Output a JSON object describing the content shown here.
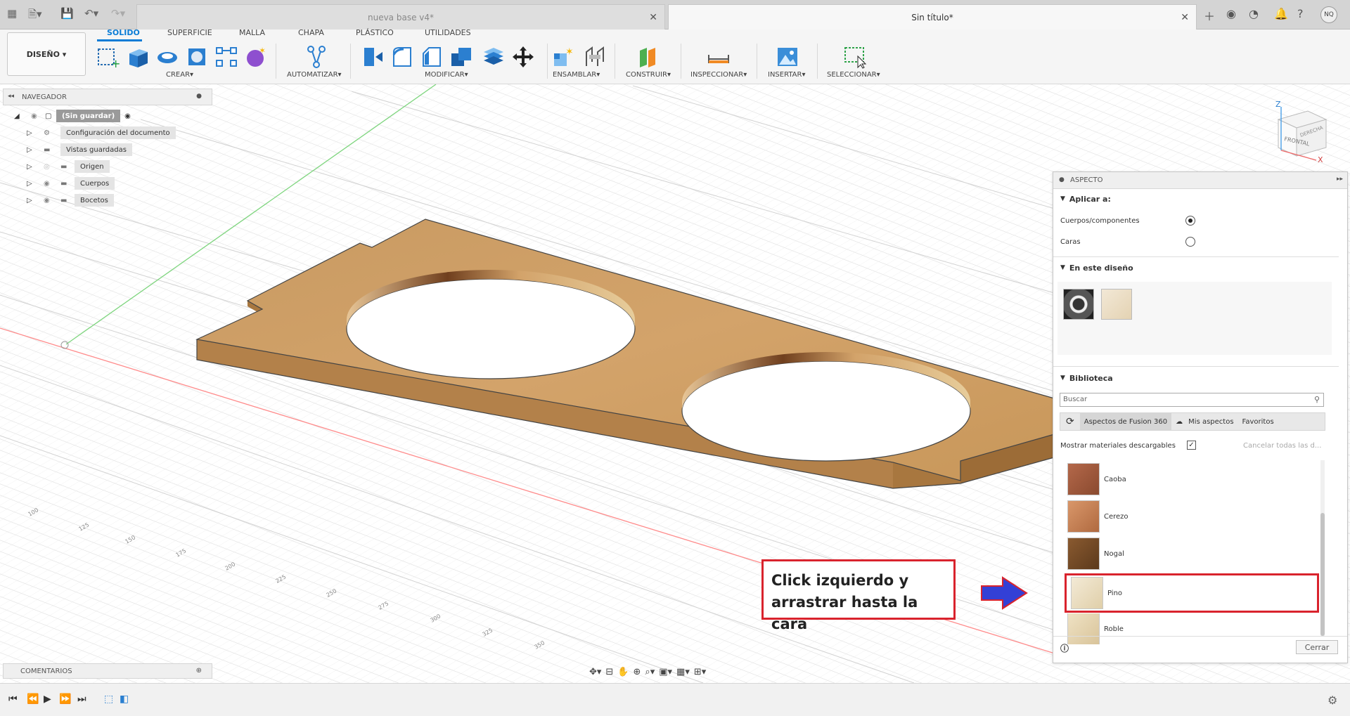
{
  "tabs": {
    "inactive": "nueva base v4*",
    "active": "Sin título*"
  },
  "user_initials": "NQ",
  "workspace": "DISEÑO",
  "menu_tabs": [
    "SOLIDO",
    "SUPERFICIE",
    "MALLA",
    "CHAPA",
    "PLÁSTICO",
    "UTILIDADES"
  ],
  "groups": [
    "CREAR",
    "AUTOMATIZAR",
    "MODIFICAR",
    "ENSAMBLAR",
    "CONSTRUIR",
    "INSPECCIONAR",
    "INSERTAR",
    "SELECCIONAR"
  ],
  "navigator": {
    "title": "NAVEGADOR",
    "root": "(Sin guardar)",
    "items": [
      "Configuración del documento",
      "Vistas guardadas",
      "Origen",
      "Cuerpos",
      "Bocetos"
    ]
  },
  "comments": "COMENTARIOS",
  "viewcube": {
    "front": "FRONTAL",
    "right": "DERECHA",
    "z": "Z",
    "x": "X"
  },
  "aspect": {
    "title": "ASPECTO",
    "apply_to": "Aplicar a:",
    "opt_bodies": "Cuerpos/componentes",
    "opt_faces": "Caras",
    "in_design": "En este diseño",
    "library": "Biblioteca",
    "search_placeholder": "Buscar",
    "lib_tab_fusion": "Aspectos de Fusion 360",
    "lib_tab_mine": "Mis aspectos",
    "lib_tab_fav": "Favoritos",
    "show_downloadable": "Mostrar materiales descargables",
    "cancel_all": "Cancelar todas las d...",
    "materials": [
      "Caoba",
      "Cerezo",
      "Nogal",
      "Pino",
      "Roble"
    ],
    "close": "Cerrar"
  },
  "callout": {
    "line1": "Click izquierdo y",
    "line2": "arrastrar hasta la cara"
  },
  "ruler_ticks": [
    "100",
    "125",
    "150",
    "175",
    "200",
    "225",
    "250",
    "275",
    "300",
    "325",
    "350"
  ],
  "colors": {
    "accent": "#0a7cd6",
    "wood": "#c8965a",
    "callout_red": "#d9232d",
    "arrow_blue": "#3340d6"
  }
}
